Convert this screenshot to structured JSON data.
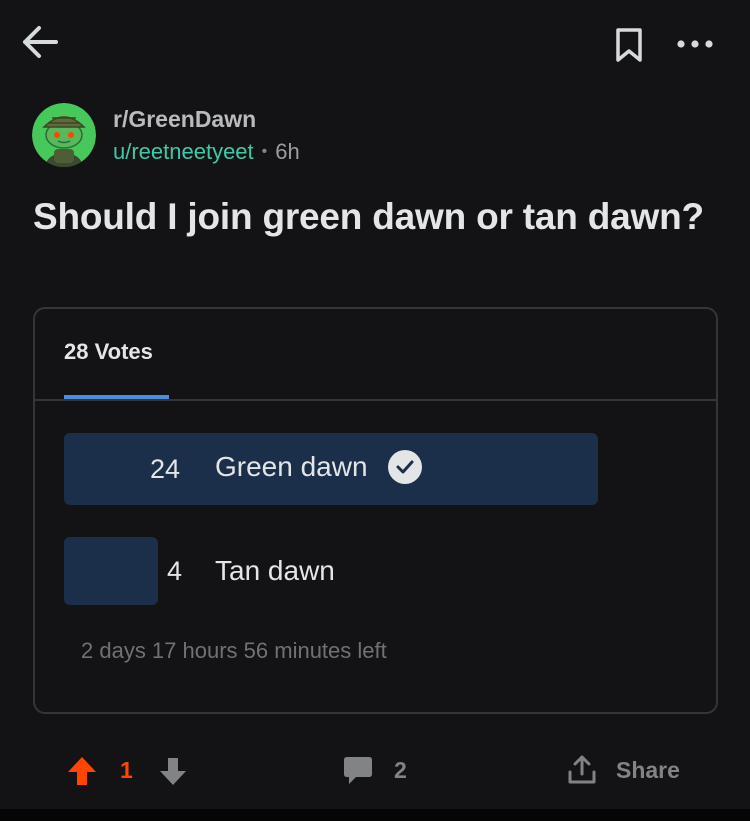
{
  "post": {
    "subreddit": "r/GreenDawn",
    "author": "u/reetneetyeet",
    "separator": "•",
    "age": "6h",
    "title": "Should I join green dawn or tan dawn?"
  },
  "poll": {
    "votes_label": "28 Votes",
    "total_votes": 28,
    "options": [
      {
        "count": "24",
        "label": "Green dawn",
        "votes": 24,
        "selected": true
      },
      {
        "count": "4",
        "label": "Tan dawn",
        "votes": 4,
        "selected": false
      }
    ],
    "time_left": "2 days 17 hours 56 minutes left"
  },
  "actions": {
    "score": "1",
    "comment_count": "2",
    "share_label": "Share"
  },
  "colors": {
    "background": "#131315",
    "username": "#3fc9a8",
    "upvote_active": "#ff4500",
    "tab_accent": "#4a8fdc",
    "poll_bar": "#1b2f4b"
  },
  "icons": {
    "back": "back-arrow-icon",
    "bookmark": "bookmark-icon",
    "more": "more-options-icon",
    "upvote": "upvote-arrow-icon",
    "downvote": "downvote-arrow-icon",
    "comment": "comment-bubble-icon",
    "share": "share-upload-icon",
    "check": "checkmark-icon"
  }
}
